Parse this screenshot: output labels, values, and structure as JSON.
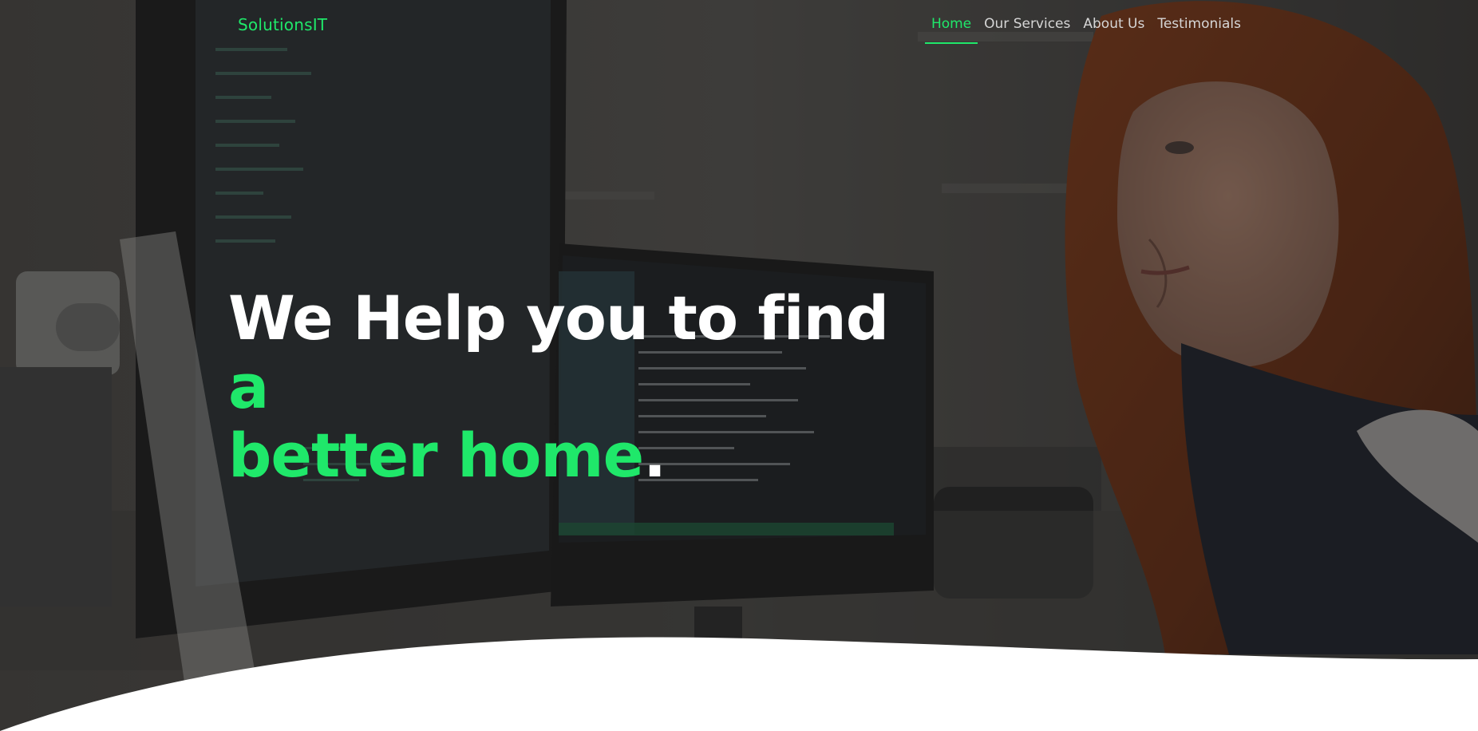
{
  "brand": {
    "name": "SolutionsIT"
  },
  "nav": {
    "items": [
      {
        "label": "Home",
        "active": true
      },
      {
        "label": "Our Services",
        "active": false
      },
      {
        "label": "About Us",
        "active": false
      },
      {
        "label": "Testimonials",
        "active": false
      }
    ]
  },
  "hero": {
    "headline_part1": "We Help you to find ",
    "headline_part2": "a",
    "headline_part3": "better home",
    "headline_part4": "."
  },
  "colors": {
    "accent": "#1fe86a",
    "overlay": "#1a1a1a",
    "wave": "#ffffff"
  }
}
